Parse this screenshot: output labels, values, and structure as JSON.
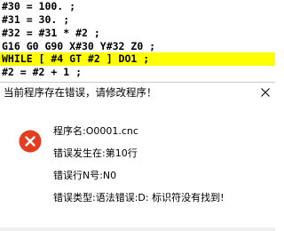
{
  "editor": {
    "lines": [
      "#30 = 100. ;",
      "#31 = 30. ;",
      "#32 = #31 * #2 ;",
      "G16 G0 G90 X#30 Y#32 Z0 ;",
      "WHILE [ #4 GT #2 ] DO1 ;",
      "#2 = #2 + 1 ;"
    ],
    "highlight_color": "#ffff00"
  },
  "dialog": {
    "title": "当前程序存在错误，请修改程序！",
    "icon": "error-icon",
    "icon_color": "#e53b1f",
    "messages": [
      "程序名:O0001.cnc",
      "错误发生在:第10行",
      "错误行N号:N0",
      "错误类型:语法错误:D: 标识符没有找到!"
    ]
  }
}
